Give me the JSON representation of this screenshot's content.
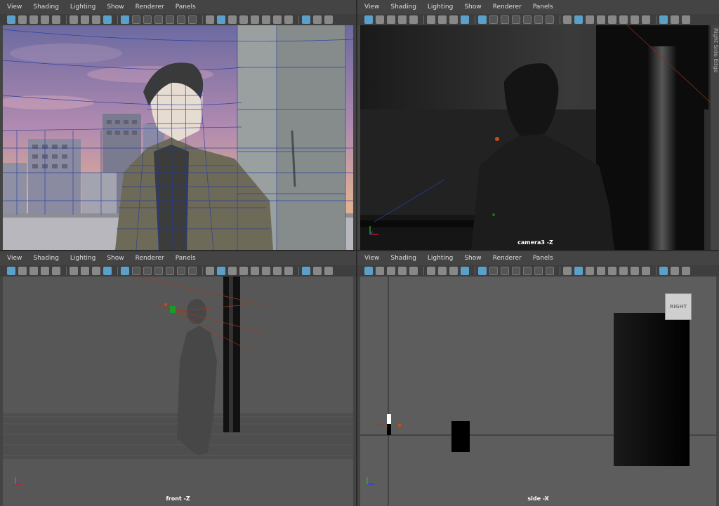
{
  "menu": [
    "View",
    "Shading",
    "Lighting",
    "Show",
    "Renderer",
    "Panels"
  ],
  "side_text": "Right Side Edge",
  "panels": {
    "top_left": {
      "label": ""
    },
    "top_right": {
      "label": "camera3 -Z"
    },
    "bottom_left": {
      "label": "front -Z"
    },
    "bottom_right": {
      "label": "side -X",
      "cube_label": "RIGHT"
    }
  },
  "colors": {
    "sky_top": "#6c6aa0",
    "sky_mid": "#b08ab0",
    "sky_low": "#e0b090",
    "wire": "#223aa0",
    "accent": "#5aa0c8",
    "bg": "#444444",
    "viewport_gray": "#5d5d5d"
  }
}
